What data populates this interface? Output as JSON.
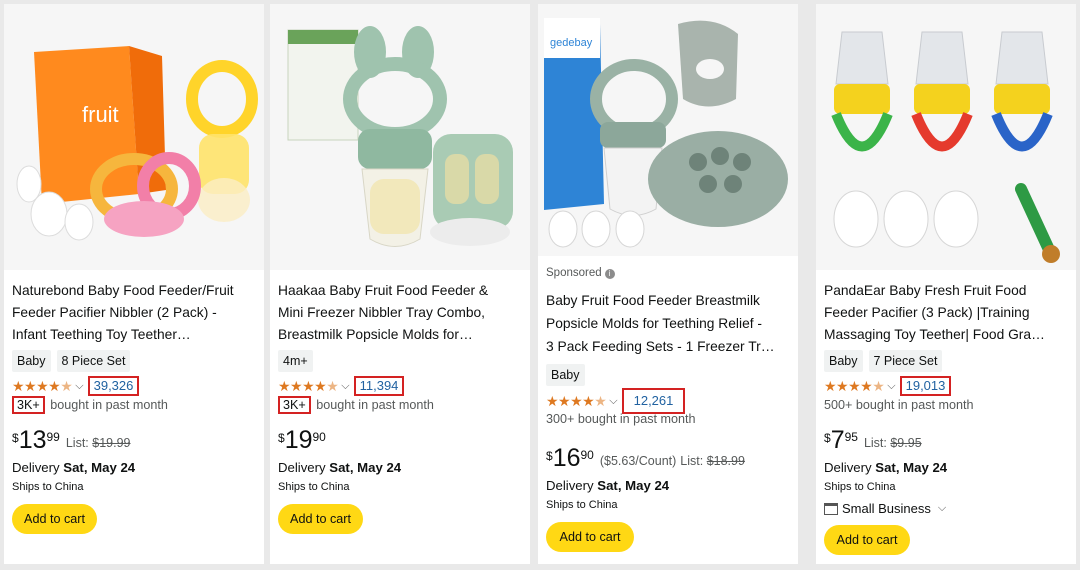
{
  "products": [
    {
      "title_line1": "Naturebond Baby Food Feeder/Fruit",
      "title_line2": "Feeder Pacifier Nibbler (2 Pack) -",
      "title_line3": "Infant Teething Toy Teether…",
      "chips": [
        "Baby",
        "8 Piece Set"
      ],
      "rating_count": "39,326",
      "bought_prefix": "3K+",
      "bought_text": " bought in past month",
      "price_symbol": "$",
      "price_whole": "13",
      "price_frac": "99",
      "list_label": "List: ",
      "list_price": "$19.99",
      "delivery_prefix": "Delivery ",
      "delivery_date": "Sat, May 24",
      "ships": "Ships to China",
      "cart_label": "Add to cart"
    },
    {
      "title_line1": "Haakaa Baby Fruit Food Feeder &",
      "title_line2": "Mini Freezer Nibbler Tray Combo,",
      "title_line3": "Breastmilk Popsicle Molds for…",
      "chips": [
        "4m+"
      ],
      "rating_count": "11,394",
      "bought_prefix": "3K+",
      "bought_text": " bought in past month",
      "price_symbol": "$",
      "price_whole": "19",
      "price_frac": "90",
      "delivery_prefix": "Delivery ",
      "delivery_date": "Sat, May 24",
      "ships": "Ships to China",
      "cart_label": "Add to cart"
    },
    {
      "sponsored": "Sponsored",
      "title_line1": "Baby Fruit Food Feeder Breastmilk",
      "title_line2": "Popsicle Molds for Teething Relief -",
      "title_line3": "3 Pack Feeding Sets - 1 Freezer Tr…",
      "chips": [
        "Baby"
      ],
      "rating_count": "12,261",
      "bought_text": "300+ bought in past month",
      "price_symbol": "$",
      "price_whole": "16",
      "price_frac": "90",
      "unit_price": "($5.63/Count)",
      "list_label": "List: ",
      "list_price": "$18.99",
      "delivery_prefix": "Delivery ",
      "delivery_date": "Sat, May 24",
      "ships": "Ships to China",
      "cart_label": "Add to cart"
    },
    {
      "title_line1": "PandaEar Baby Fresh Fruit Food",
      "title_line2": "Feeder Pacifier (3 Pack) |Training",
      "title_line3": "Massaging Toy Teether| Food Gra…",
      "chips": [
        "Baby",
        "7 Piece Set"
      ],
      "rating_count": "19,013",
      "bought_text": "500+ bought in past month",
      "price_symbol": "$",
      "price_whole": "7",
      "price_frac": "95",
      "list_label": "List: ",
      "list_price": "$9.95",
      "delivery_prefix": "Delivery ",
      "delivery_date": "Sat, May 24",
      "ships": "Ships to China",
      "small_business": "Small Business",
      "cart_label": "Add to cart"
    }
  ],
  "image_labels": {
    "p1_box_brand": "fruit",
    "p3_box_brand": "gedebay"
  },
  "colors": {
    "star": "#de7921",
    "link": "#2162a1",
    "highlight_box": "#d42222",
    "cart_button": "#ffd814"
  },
  "icons": {
    "rating": "star-icon",
    "chevron": "chevron-down-icon",
    "info": "info-icon",
    "small_business": "store-icon"
  }
}
